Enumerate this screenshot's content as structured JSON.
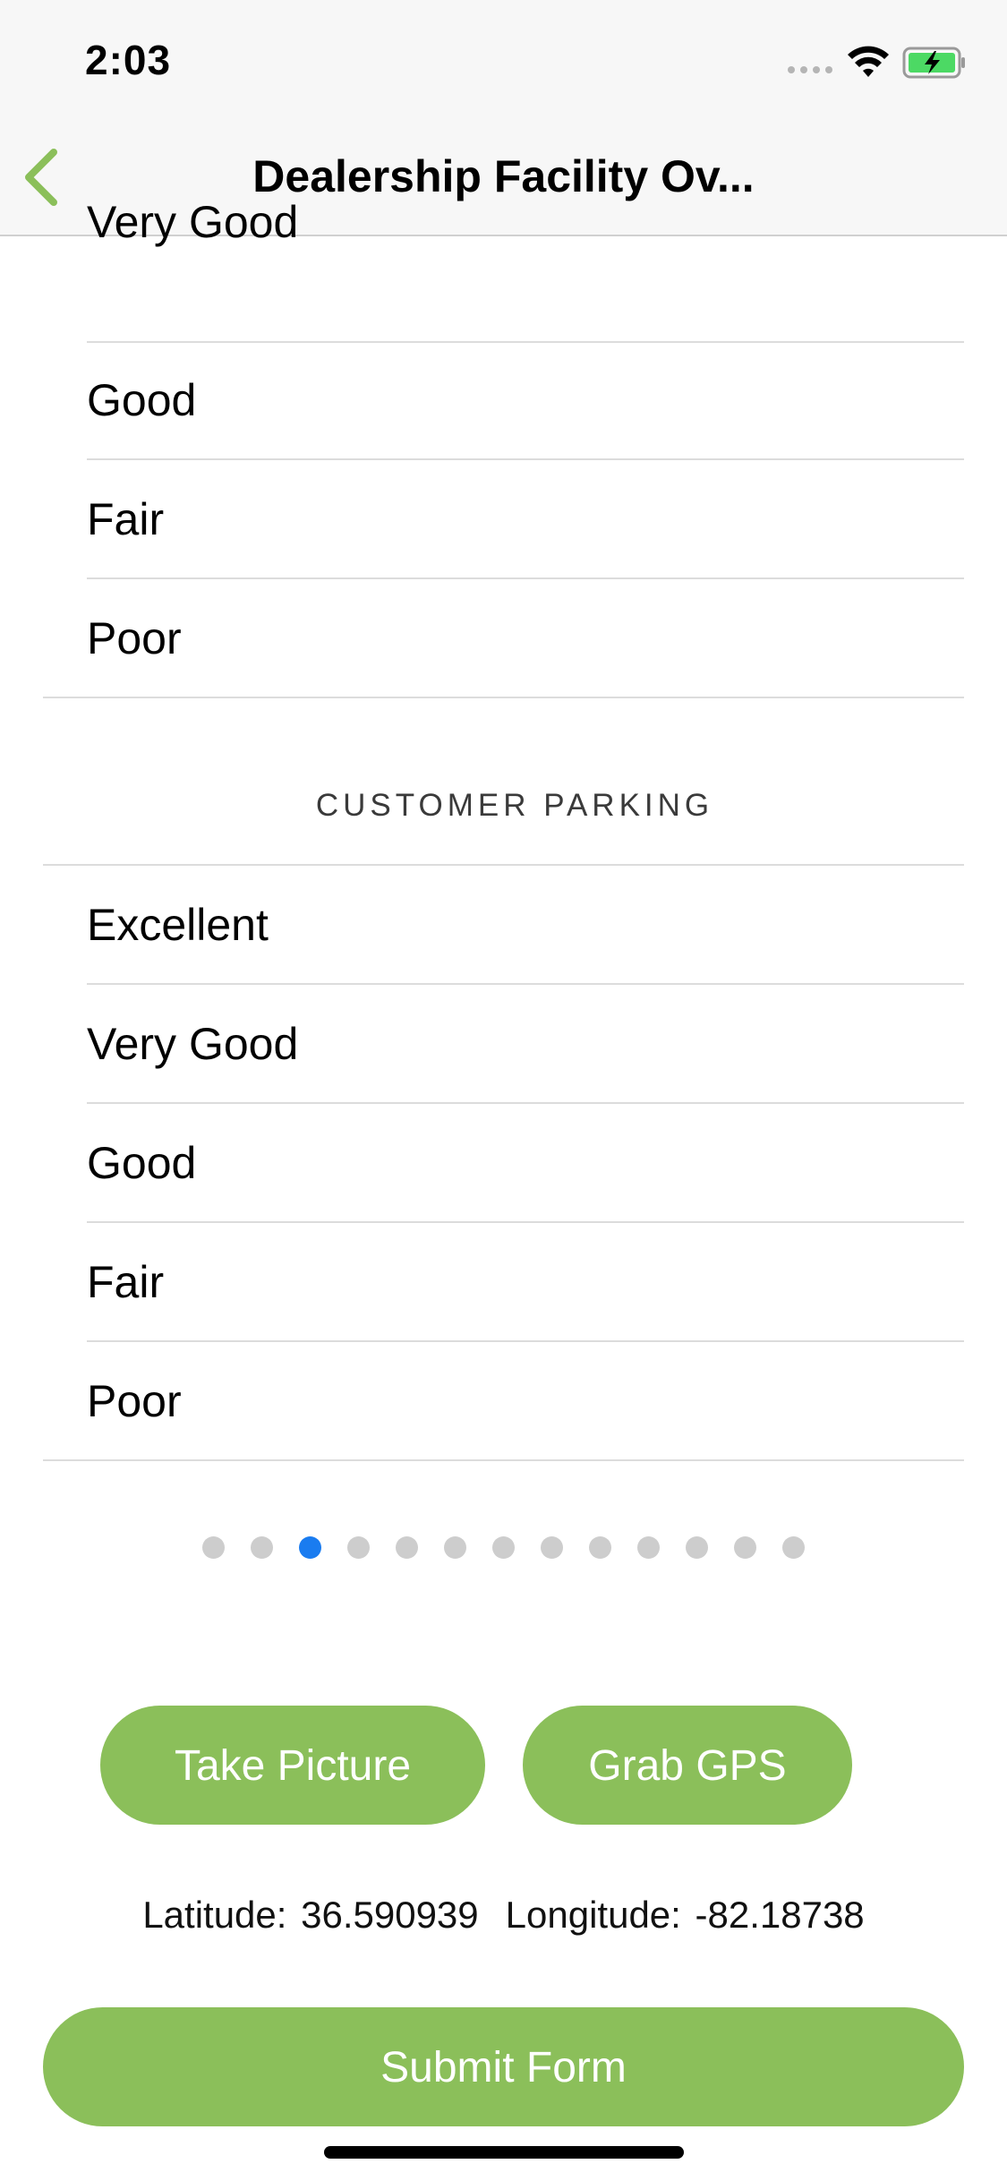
{
  "status_bar": {
    "time": "2:03"
  },
  "nav": {
    "title": "Dealership Facility Ov..."
  },
  "section_prev": {
    "options": [
      "Very Good",
      "Good",
      "Fair",
      "Poor"
    ]
  },
  "section_parking": {
    "header": "CUSTOMER PARKING",
    "options": [
      "Excellent",
      "Very Good",
      "Good",
      "Fair",
      "Poor"
    ]
  },
  "pagination": {
    "total": 13,
    "current": 3
  },
  "actions": {
    "take_picture": "Take Picture",
    "grab_gps": "Grab GPS",
    "submit": "Submit Form"
  },
  "gps": {
    "latitude_label": "Latitude: 36.590939",
    "longitude_label": "Longitude: -82.18738"
  },
  "colors": {
    "accent": "#8bbf5a",
    "page_dot_active": "#1a7cf0",
    "page_dot_inactive": "#cdcdcd"
  }
}
